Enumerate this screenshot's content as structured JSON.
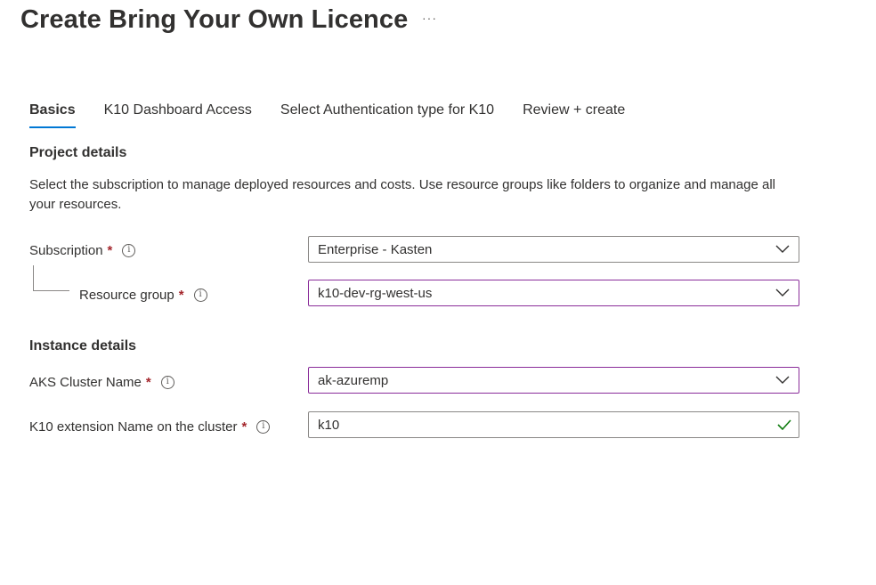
{
  "page": {
    "title": "Create Bring Your Own Licence",
    "more_label": "···"
  },
  "tabs": [
    {
      "label": "Basics",
      "active": true
    },
    {
      "label": "K10 Dashboard Access",
      "active": false
    },
    {
      "label": "Select Authentication type for K10",
      "active": false
    },
    {
      "label": "Review + create",
      "active": false
    }
  ],
  "project_details": {
    "title": "Project details",
    "description": "Select the subscription to manage deployed resources and costs. Use resource groups like folders to organize and manage all your resources."
  },
  "subscription": {
    "label": "Subscription",
    "required": "*",
    "info_icon": "i",
    "value": "Enterprise - Kasten"
  },
  "resource_group": {
    "label": "Resource group",
    "required": "*",
    "info_icon": "i",
    "value": "k10-dev-rg-west-us"
  },
  "instance_details": {
    "title": "Instance details"
  },
  "aks_cluster": {
    "label": "AKS Cluster Name",
    "required": "*",
    "info_icon": "i",
    "value": "ak-azuremp"
  },
  "extension_name": {
    "label": "K10 extension Name on the cluster",
    "required": "*",
    "info_icon": "i",
    "value": "k10"
  },
  "colors": {
    "accent": "#0078d4",
    "focus_border": "#8a2d9a",
    "required": "#a4262c",
    "valid_check": "#107c10"
  }
}
